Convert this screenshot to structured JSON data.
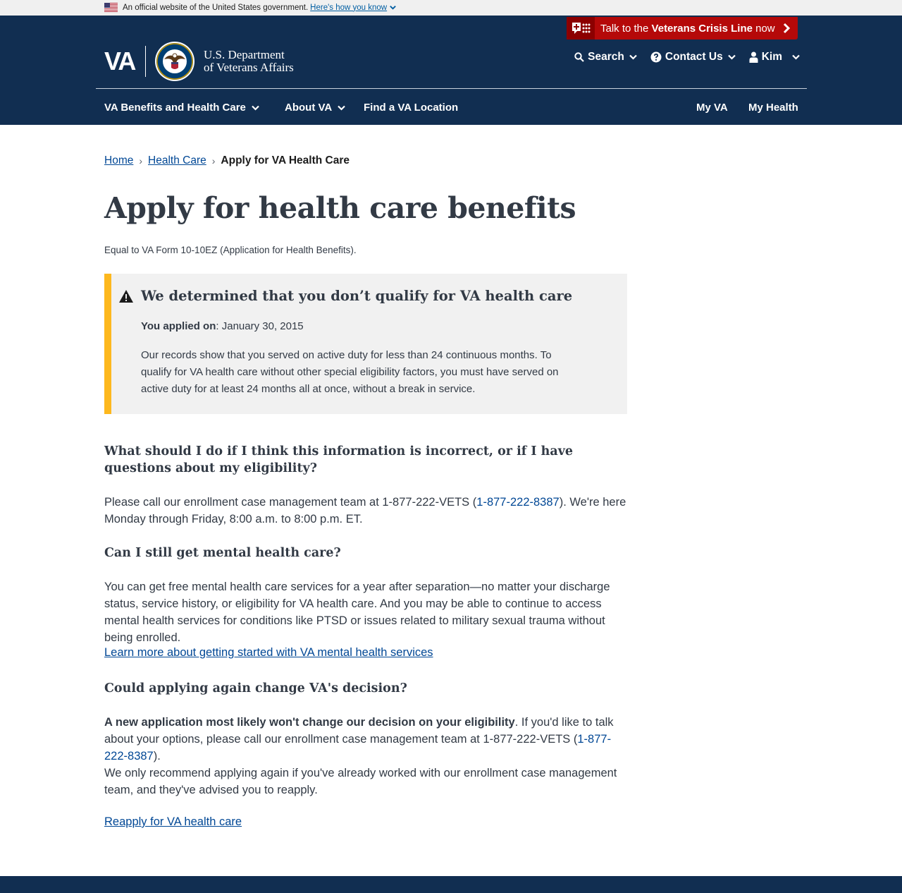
{
  "banner": {
    "text": "An official website of the United States government.",
    "link": "Here's how you know"
  },
  "crisis": {
    "prefix": "Talk to the ",
    "bold": "Veterans Crisis Line",
    "suffix": " now"
  },
  "logo": {
    "va": "VA",
    "line1": "U.S. Department",
    "line2": "of Veterans Affairs"
  },
  "util_nav": {
    "search": "Search",
    "contact": "Contact Us",
    "user": "Kim"
  },
  "main_nav": {
    "benefits": "VA Benefits and Health Care",
    "about": "About VA",
    "find": "Find a VA Location",
    "my_va": "My VA",
    "my_health": "My Health"
  },
  "breadcrumb": {
    "home": "Home",
    "health_care": "Health Care",
    "current": "Apply for VA Health Care",
    "separator": "›"
  },
  "page": {
    "title": "Apply for health care benefits",
    "form_equal": "Equal to VA Form 10-10EZ (Application for Health Benefits)."
  },
  "alert": {
    "heading": "We determined that you don’t qualify for VA health care",
    "applied_label": "You applied on",
    "applied_date": ": January 30, 2015",
    "body": "Our records show that you served on active duty for less than 24 continuous months. To qualify for VA health care without other special eligibility factors, you must have served on active duty for at least 24 months all at once, without a break in service."
  },
  "sections": {
    "q1": "What should I do if I think this information is incorrect, or if I have questions about my eligibility?",
    "p1_a": "Please call our enrollment case management team at 1-877-222-VETS (",
    "p1_phone": "1-877-222-8387",
    "p1_b": "). We're here Monday through Friday, 8:00 a.m. to 8:00 p.m. ET.",
    "q2": "Can I still get mental health care?",
    "p2": "You can get free mental health care services for a year after separation—no matter your discharge status, service history, or eligibility for VA health care. And you may be able to continue to access mental health services for conditions like PTSD or issues related to military sexual trauma without being enrolled.",
    "link2": "Learn more about getting started with VA mental health services",
    "q3": "Could applying again change VA's decision?",
    "p3_bold": "A new application most likely won't change our decision on your eligibility",
    "p3_a": ". If you'd like to talk about your options, please call our enrollment case management team at 1-877-222-VETS (",
    "p3_phone": "1-877-222-8387",
    "p3_b": ").",
    "p4": "We only recommend applying again if you've already worked with our enrollment case management team, and they've advised you to reapply.",
    "link4": "Reapply for VA health care"
  },
  "colors": {
    "header": "#112e51",
    "crisis": "#b50909",
    "alert_border": "#fdb81e",
    "link": "#004795"
  }
}
